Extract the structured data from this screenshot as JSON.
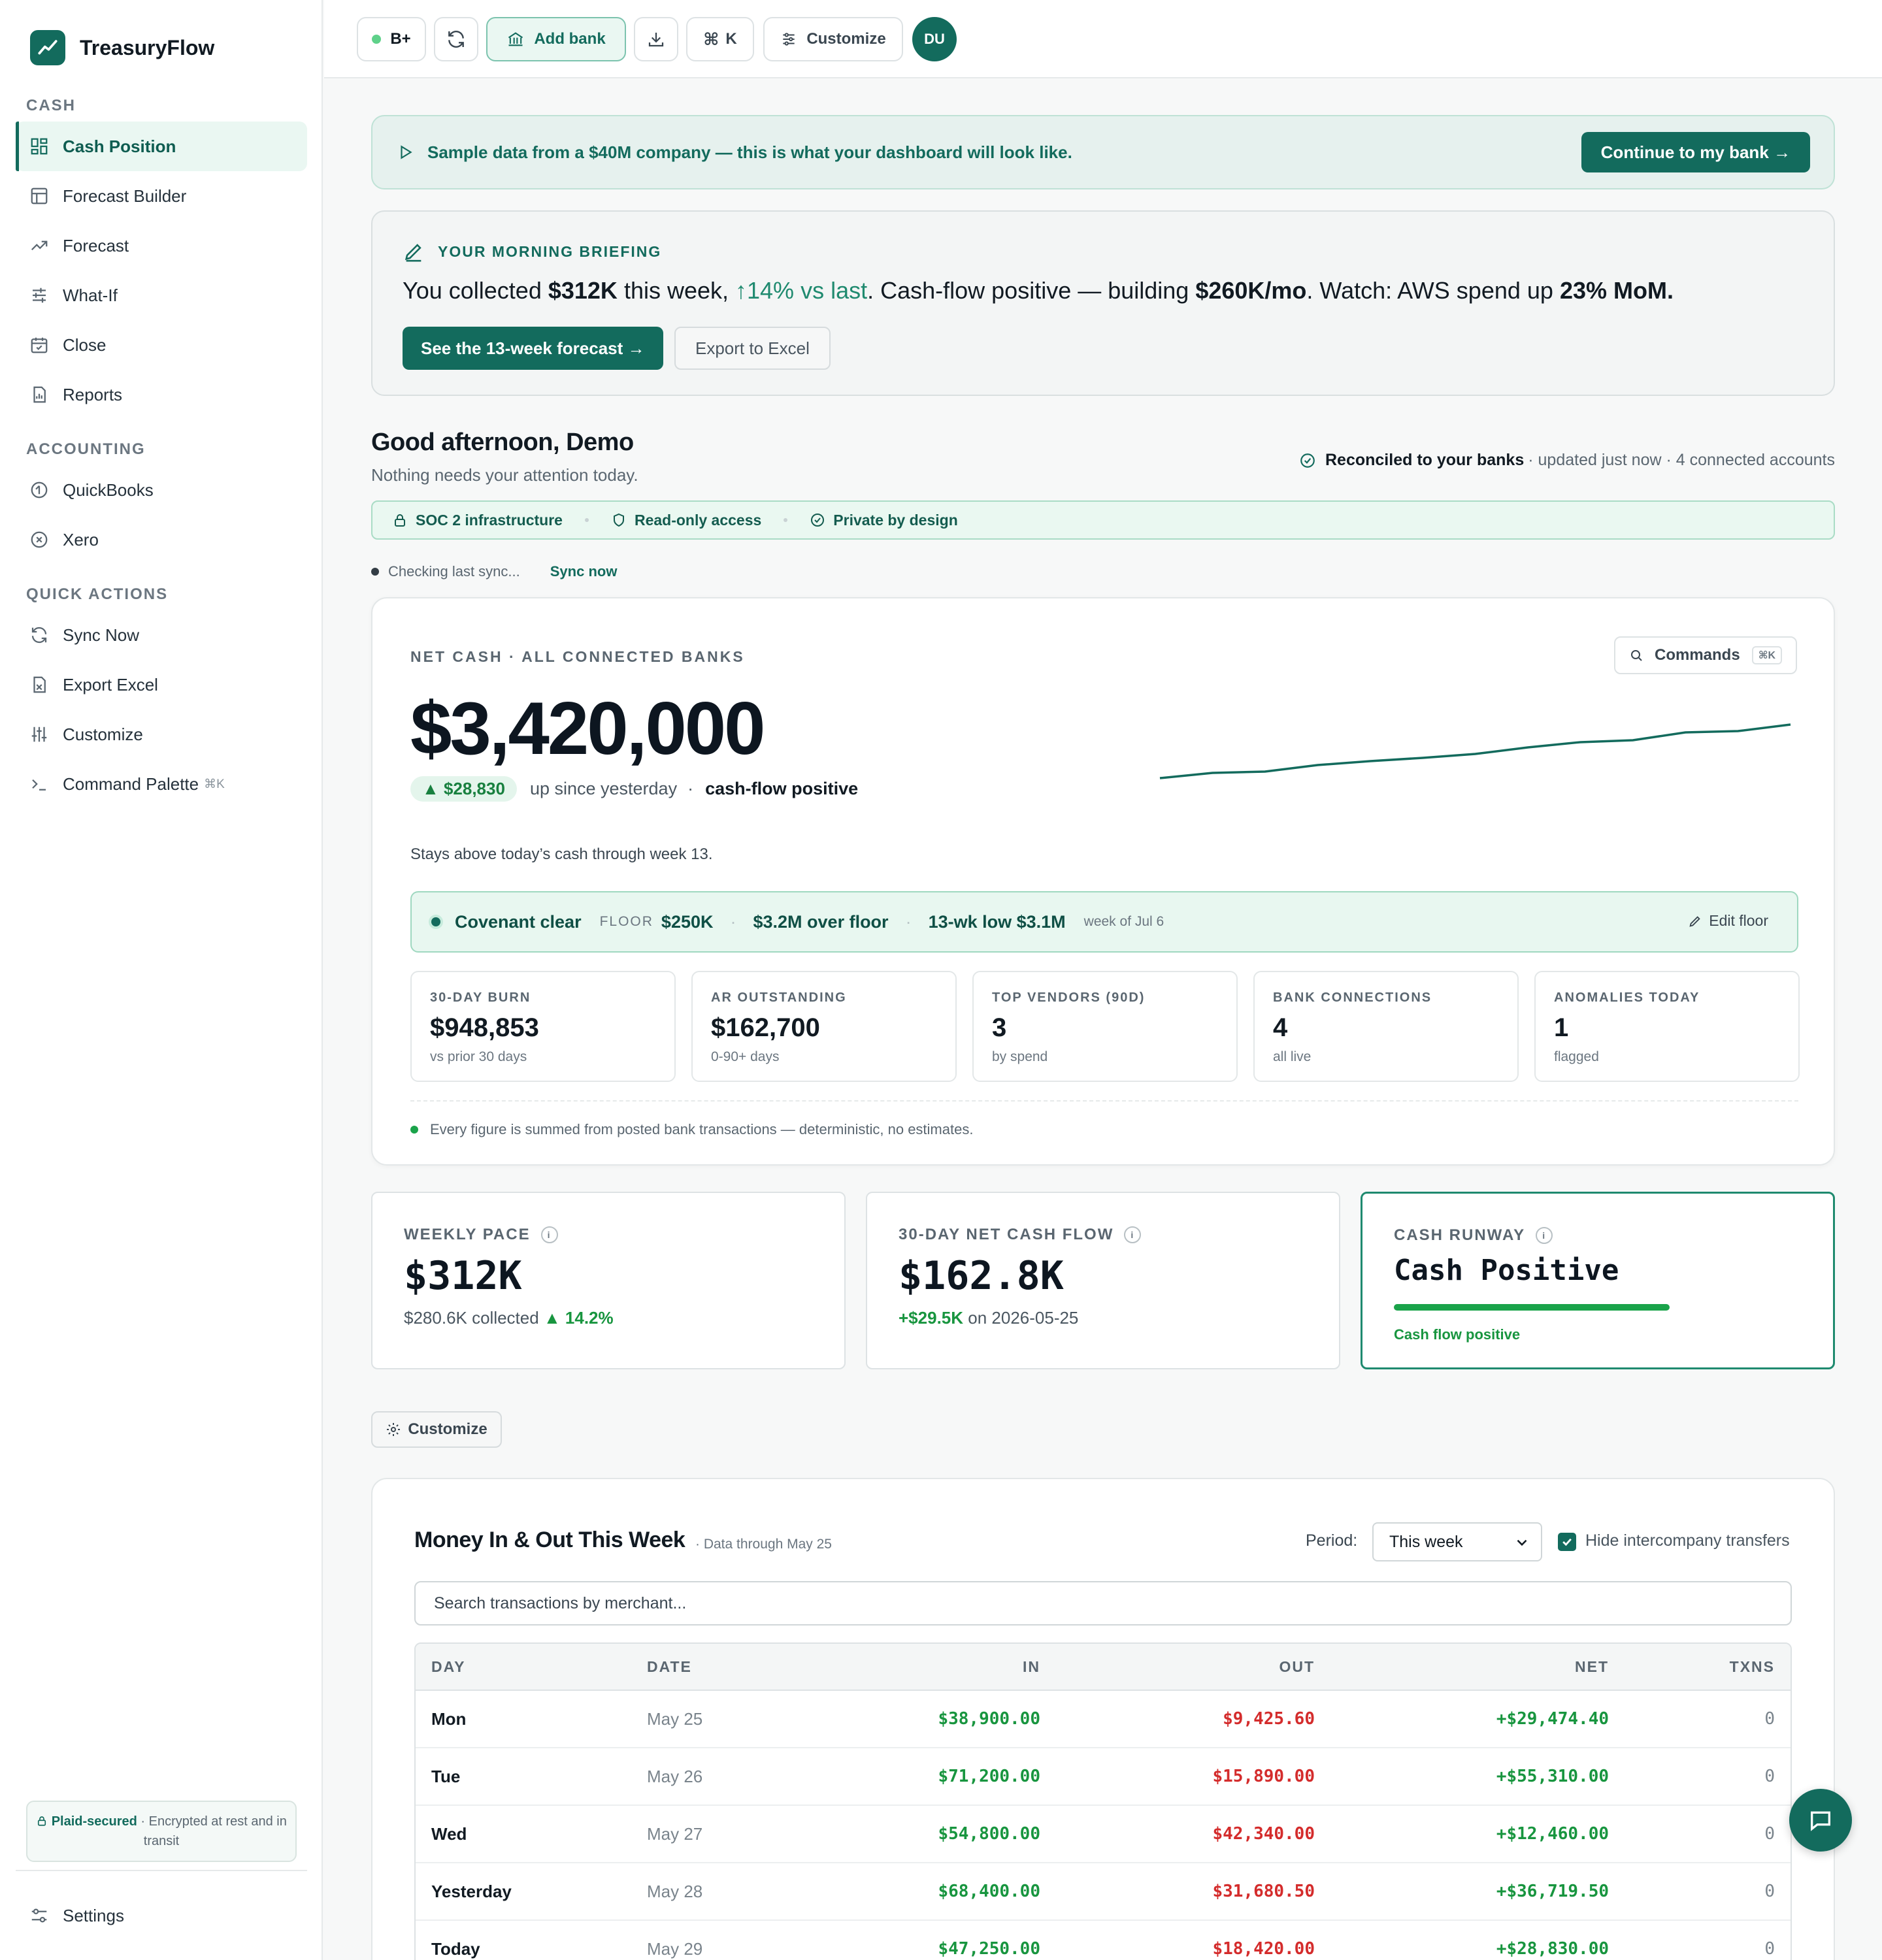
{
  "app": {
    "name": "TreasuryFlow"
  },
  "sidebar": {
    "sections": [
      {
        "title": "CASH",
        "items": [
          {
            "label": "Cash Position",
            "icon": "dashboard-icon",
            "active": true
          },
          {
            "label": "Forecast Builder",
            "icon": "table-icon"
          },
          {
            "label": "Forecast",
            "icon": "trend-icon"
          },
          {
            "label": "What-If",
            "icon": "sliders-icon"
          },
          {
            "label": "Close",
            "icon": "calendar-check-icon"
          },
          {
            "label": "Reports",
            "icon": "report-icon"
          }
        ]
      },
      {
        "title": "ACCOUNTING",
        "items": [
          {
            "label": "QuickBooks",
            "icon": "quickbooks-icon"
          },
          {
            "label": "Xero",
            "icon": "xero-icon"
          }
        ]
      },
      {
        "title": "QUICK ACTIONS",
        "items": [
          {
            "label": "Sync Now",
            "icon": "sync-icon"
          },
          {
            "label": "Export Excel",
            "icon": "excel-icon"
          },
          {
            "label": "Customize",
            "icon": "customize-icon"
          },
          {
            "label": "Command Palette",
            "icon": "terminal-icon",
            "hint": "⌘K"
          }
        ]
      }
    ],
    "security_brand": "Plaid-secured",
    "security_text": "· Encrypted at rest and in transit",
    "settings_label": "Settings"
  },
  "topbar": {
    "grade": "B+",
    "add_bank": "Add bank",
    "cmd_k": "K",
    "customize": "Customize",
    "avatar": "DU"
  },
  "banner": {
    "text": "Sample data from a $40M company — this is what your dashboard will look like.",
    "cta": "Continue to my bank →"
  },
  "briefing": {
    "label": "YOUR MORNING BRIEFING",
    "t1": "You collected ",
    "b1": "$312K",
    "t2": " this week, ",
    "up": "↑14% vs last",
    "t3": ". Cash-flow positive — building ",
    "b2": "$260K/mo",
    "t4": ". Watch: AWS spend up ",
    "b3": "23% MoM.",
    "primary_btn": "See the 13-week forecast →",
    "secondary_btn": "Export to Excel"
  },
  "greeting": {
    "title": "Good afternoon, Demo",
    "subtitle": "Nothing needs your attention today.",
    "reconciled": "Reconciled to your banks",
    "reconciled_meta": "· updated just now · 4 connected accounts"
  },
  "trust": [
    {
      "label": "SOC 2 infrastructure",
      "icon": "lock-icon"
    },
    {
      "label": "Read-only access",
      "icon": "shield-icon"
    },
    {
      "label": "Private by design",
      "icon": "check-circle-icon"
    }
  ],
  "sync": {
    "status": "Checking last sync...",
    "action": "Sync now"
  },
  "hero": {
    "label": "NET CASH · ALL CONNECTED BANKS",
    "commands": "Commands",
    "commands_kbd": "⌘K",
    "value": "$3,420,000",
    "delta": "▲ $28,830",
    "delta_text": "up since yesterday",
    "delta_sep": "·",
    "delta_strong": "cash-flow positive",
    "note": "Stays above today’s cash through week 13.",
    "covenant": {
      "status": "Covenant clear",
      "floor_label": "FLOOR",
      "floor_value": "$250K",
      "over_floor": "$3.2M over floor",
      "low": "13-wk low $3.1M",
      "low_date": "week of Jul 6",
      "edit": "Edit floor"
    },
    "kpis": [
      {
        "label": "30-DAY BURN",
        "value": "$948,853",
        "sub": "vs prior 30 days"
      },
      {
        "label": "AR OUTSTANDING",
        "value": "$162,700",
        "sub": "0-90+ days"
      },
      {
        "label": "TOP VENDORS (90D)",
        "value": "3",
        "sub": "by spend"
      },
      {
        "label": "BANK CONNECTIONS",
        "value": "4",
        "sub": "all live"
      },
      {
        "label": "ANOMALIES TODAY",
        "value": "1",
        "sub": "flagged"
      }
    ],
    "footnote": "Every figure is summed from posted bank transactions — deterministic, no estimates.",
    "sparkline": [
      0.0,
      0.08,
      0.1,
      0.2,
      0.26,
      0.31,
      0.37,
      0.47,
      0.55,
      0.58,
      0.7,
      0.72,
      0.82
    ]
  },
  "metrics": [
    {
      "label": "WEEKLY PACE",
      "value": "$312K",
      "sub": "$280.6K collected",
      "sub_accent": "▲ 14.2%"
    },
    {
      "label": "30-DAY NET CASH FLOW",
      "value": "$162.8K",
      "sub_accent": "+$29.5K",
      "sub": " on 2026-05-25"
    },
    {
      "label": "CASH RUNWAY",
      "value": "Cash Positive",
      "note": "Cash flow positive"
    }
  ],
  "customize_chip": "Customize",
  "table": {
    "title": "Money In & Out This Week",
    "subtitle": "· Data through May 25",
    "period_label": "Period:",
    "period_value": "This week",
    "hide_intercompany": "Hide intercompany transfers",
    "search_placeholder": "Search transactions by merchant...",
    "columns": [
      "DAY",
      "DATE",
      "IN",
      "OUT",
      "NET",
      "TXNS"
    ],
    "rows": [
      [
        "Mon",
        "May 25",
        "$38,900.00",
        "$9,425.60",
        "+$29,474.40",
        "0"
      ],
      [
        "Tue",
        "May 26",
        "$71,200.00",
        "$15,890.00",
        "+$55,310.00",
        "0"
      ],
      [
        "Wed",
        "May 27",
        "$54,800.00",
        "$42,340.00",
        "+$12,460.00",
        "0"
      ],
      [
        "Yesterday",
        "May 28",
        "$68,400.00",
        "$31,680.50",
        "+$36,719.50",
        "0"
      ],
      [
        "Today",
        "May 29",
        "$47,250.00",
        "$18,420.00",
        "+$28,830.00",
        "0"
      ]
    ]
  }
}
